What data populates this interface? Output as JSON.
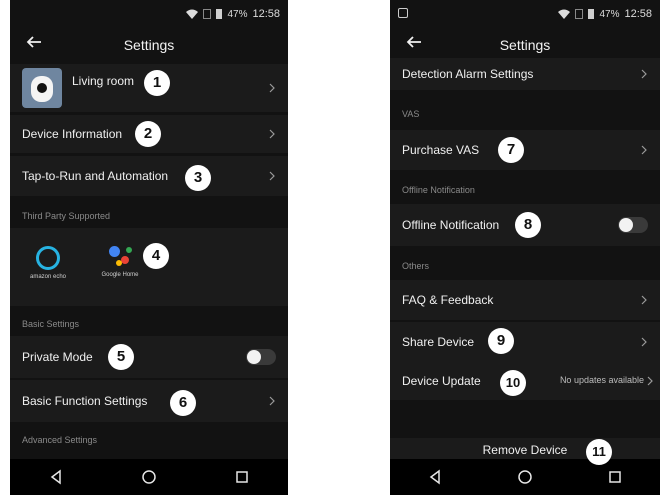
{
  "status_bar": {
    "battery": "47%",
    "time": "12:58"
  },
  "left": {
    "title": "Settings",
    "device_name": "Living room",
    "rows": {
      "device_information": "Device Information",
      "tap_to_run": "Tap-to-Run and Automation",
      "private_mode": "Private Mode",
      "basic_function": "Basic Function Settings"
    },
    "sections": {
      "third_party": "Third Party Supported",
      "basic_settings": "Basic Settings",
      "advanced_settings": "Advanced Settings"
    },
    "third_party": {
      "alexa_label": "amazon echo",
      "google_label": "Google Home"
    },
    "private_mode_on": false
  },
  "right": {
    "title": "Settings",
    "rows": {
      "detection_alarm": "Detection Alarm Settings",
      "purchase_vas": "Purchase VAS",
      "offline_notification": "Offline Notification",
      "faq": "FAQ & Feedback",
      "share_device": "Share Device",
      "device_update": "Device Update",
      "device_update_value": "No updates available"
    },
    "sections": {
      "vas": "VAS",
      "offline_notification": "Offline Notification",
      "others": "Others"
    },
    "remove_device": "Remove Device",
    "offline_notification_on": false
  },
  "badges": [
    "1",
    "2",
    "3",
    "4",
    "5",
    "6",
    "7",
    "8",
    "9",
    "10",
    "11"
  ],
  "colors": {
    "background": "#121212",
    "row": "#1b1b1b",
    "alexa": "#27b3e2",
    "badge": "#ffffff"
  }
}
